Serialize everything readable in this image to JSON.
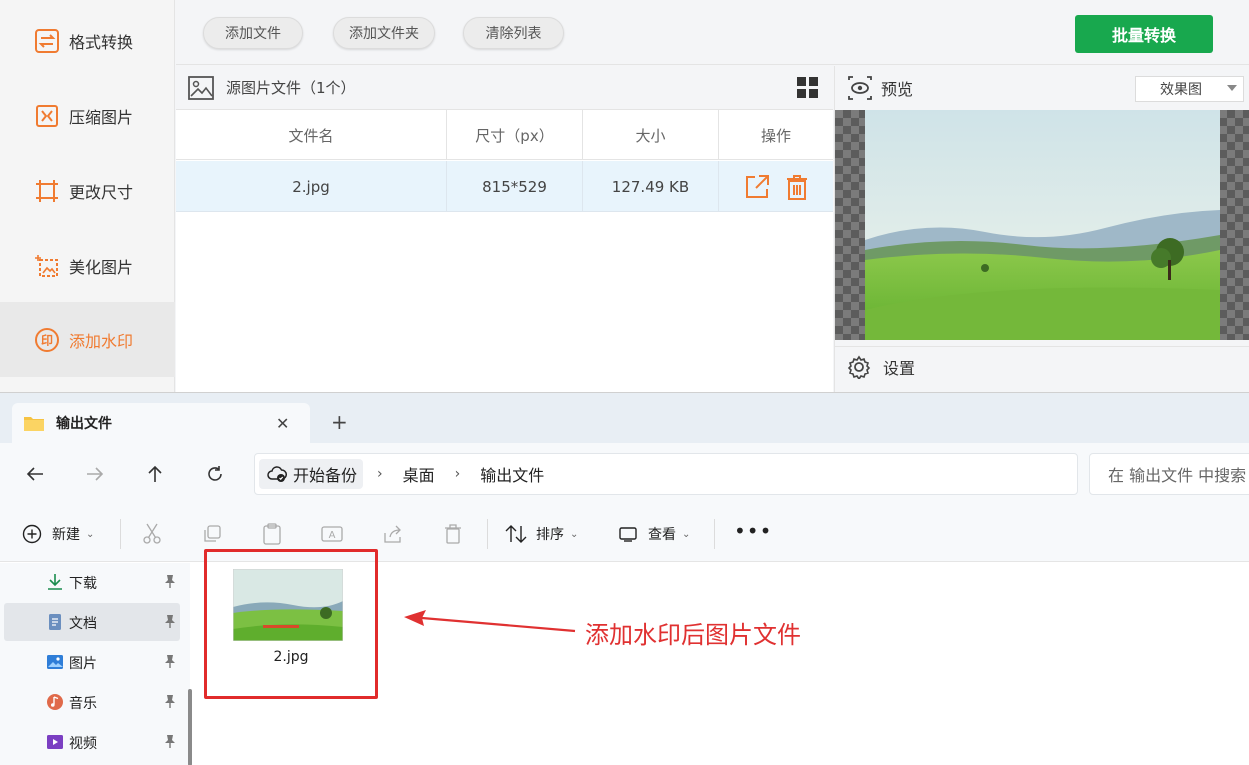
{
  "app": {
    "sidebar": {
      "items": [
        {
          "label": "格式转换",
          "icon": "format-convert-icon"
        },
        {
          "label": "压缩图片",
          "icon": "compress-icon"
        },
        {
          "label": "更改尺寸",
          "icon": "resize-icon"
        },
        {
          "label": "美化图片",
          "icon": "beautify-icon"
        },
        {
          "label": "添加水印",
          "icon": "watermark-icon",
          "active": true
        }
      ],
      "accent_color": "#f07b31"
    },
    "toolbar": {
      "add_file": "添加文件",
      "add_folder": "添加文件夹",
      "clear_list": "清除列表",
      "batch_convert": "批量转换",
      "batch_color": "#18a84e"
    },
    "file_panel": {
      "title": "源图片文件（1个）",
      "columns": [
        "文件名",
        "尺寸（px）",
        "大小",
        "操作"
      ],
      "rows": [
        {
          "name": "2.jpg",
          "dimensions": "815*529",
          "size": "127.49 KB"
        }
      ]
    },
    "preview": {
      "title": "预览",
      "mode": "效果图",
      "settings_title": "设置"
    }
  },
  "explorer": {
    "tab_title": "输出文件",
    "breadcrumb": [
      "开始备份",
      "桌面",
      "输出文件"
    ],
    "search_placeholder": "在 输出文件 中搜索",
    "commands": {
      "new": "新建",
      "sort": "排序",
      "view": "查看"
    },
    "nav_items": [
      {
        "label": "下载",
        "icon": "download-icon"
      },
      {
        "label": "文档",
        "icon": "document-icon",
        "selected": true
      },
      {
        "label": "图片",
        "icon": "pictures-icon"
      },
      {
        "label": "音乐",
        "icon": "music-icon"
      },
      {
        "label": "视频",
        "icon": "video-icon"
      }
    ],
    "files": [
      {
        "name": "2.jpg"
      }
    ],
    "annotation": "添加水印后图片文件",
    "annotation_color": "#e03131"
  }
}
